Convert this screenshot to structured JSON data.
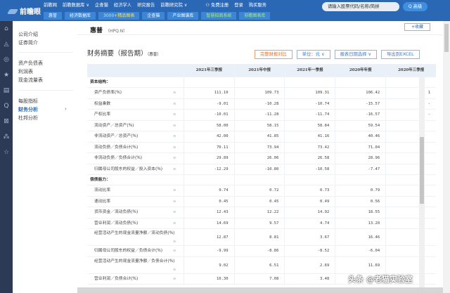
{
  "header": {
    "logo": "前瞻眼",
    "nav": [
      "前瞻网",
      "前瞻数据库 ∨",
      "企查猫",
      "经济学人",
      "研究报告",
      "前瞻研究院 ∨",
      "⚇ 免费注册",
      "登录",
      "购买服务"
    ],
    "subnav": [
      "惠誉",
      "经济数据库",
      "3000+精品图表",
      "企查猫",
      "产业图谱库",
      "智慧招商系统",
      "前瞻图表库"
    ],
    "search_placeholder": "请输入股票代码/名称/简拼",
    "search_button": "Q 高级"
  },
  "sidebar": {
    "groups": [
      [
        "公司介绍",
        "证券简介"
      ],
      [
        "资产负债表",
        "利润表",
        "现金流量表"
      ],
      [
        "每股指标",
        "财务分析",
        "杜邦分析"
      ]
    ],
    "active": "财务分析"
  },
  "company": {
    "name": "惠普",
    "code": "（HPQ.N）",
    "fav": "+收藏"
  },
  "section": {
    "title": "财务摘要（报告期）",
    "sub": "（惠普）"
  },
  "toolbar": {
    "compare": "完整财报对比",
    "unit": "单位：元 ∨",
    "date": "报表日期选择 ∨",
    "export": "导出到EXCEL"
  },
  "table": {
    "columns": [
      "2021年三季报",
      "2021年中报",
      "2021年一季报",
      "2020年年报",
      "2020年三季报"
    ],
    "rows": [
      {
        "section": "资本结构："
      },
      {
        "label": "资产负债率(%)",
        "values": [
          "111.10",
          "109.73",
          "109.31",
          "106.42",
          "1"
        ]
      },
      {
        "label": "权益乘数",
        "values": [
          "-9.01",
          "-10.28",
          "-10.74",
          "-15.57",
          "-"
        ]
      },
      {
        "label": "产权比率",
        "values": [
          "-10.01",
          "-11.28",
          "-11.74",
          "-16.57",
          "-"
        ]
      },
      {
        "label": "流动资产／总资产(%)",
        "values": [
          "58.00",
          "58.15",
          "58.84",
          "59.54",
          ""
        ]
      },
      {
        "label": "非流动资产／总资产(%)",
        "values": [
          "42.00",
          "41.85",
          "41.16",
          "40.46",
          ""
        ]
      },
      {
        "label": "流动负债／负债合计(%)",
        "values": [
          "70.11",
          "73.94",
          "73.42",
          "71.04",
          ""
        ]
      },
      {
        "label": "非流动负债／负债合计(%)",
        "values": [
          "29.89",
          "26.06",
          "26.58",
          "28.96",
          ""
        ]
      },
      {
        "label": "归属母公司股东的权益／投入资本(%)",
        "values": [
          "-12.29",
          "-10.80",
          "-10.58",
          "-7.47",
          ""
        ]
      },
      {
        "section": "偿债能力："
      },
      {
        "label": "流动比率",
        "values": [
          "0.74",
          "0.72",
          "0.73",
          "0.79",
          ""
        ]
      },
      {
        "label": "速动比率",
        "values": [
          "0.45",
          "0.45",
          "0.49",
          "0.56",
          ""
        ]
      },
      {
        "label": "货币资金／流动负债(%)",
        "values": [
          "12.43",
          "12.22",
          "14.92",
          "18.55",
          ""
        ]
      },
      {
        "label": "营业利润／流动负债(%)",
        "values": [
          "14.69",
          "9.57",
          "4.74",
          "13.20",
          ""
        ]
      },
      {
        "label": "经营活动产生的现金流量净额／流动负债(%)",
        "values": [
          "12.87",
          "8.81",
          "3.67",
          "16.46",
          ""
        ],
        "tall": true
      },
      {
        "label": "归属母公司股东的权益／负债合计(%)",
        "values": [
          "-9.99",
          "-8.86",
          "-8.52",
          "-6.04",
          ""
        ]
      },
      {
        "label": "经营活动产生的现金流量净额／负债合计(%)",
        "values": [
          "9.02",
          "6.51",
          "2.69",
          "11.69",
          ""
        ],
        "tall": true
      },
      {
        "label": "营业利润／负债合计(%)",
        "values": [
          "10.30",
          "7.08",
          "3.48",
          "",
          ""
        ]
      }
    ]
  },
  "watermark": "头条 @老猫实验室"
}
